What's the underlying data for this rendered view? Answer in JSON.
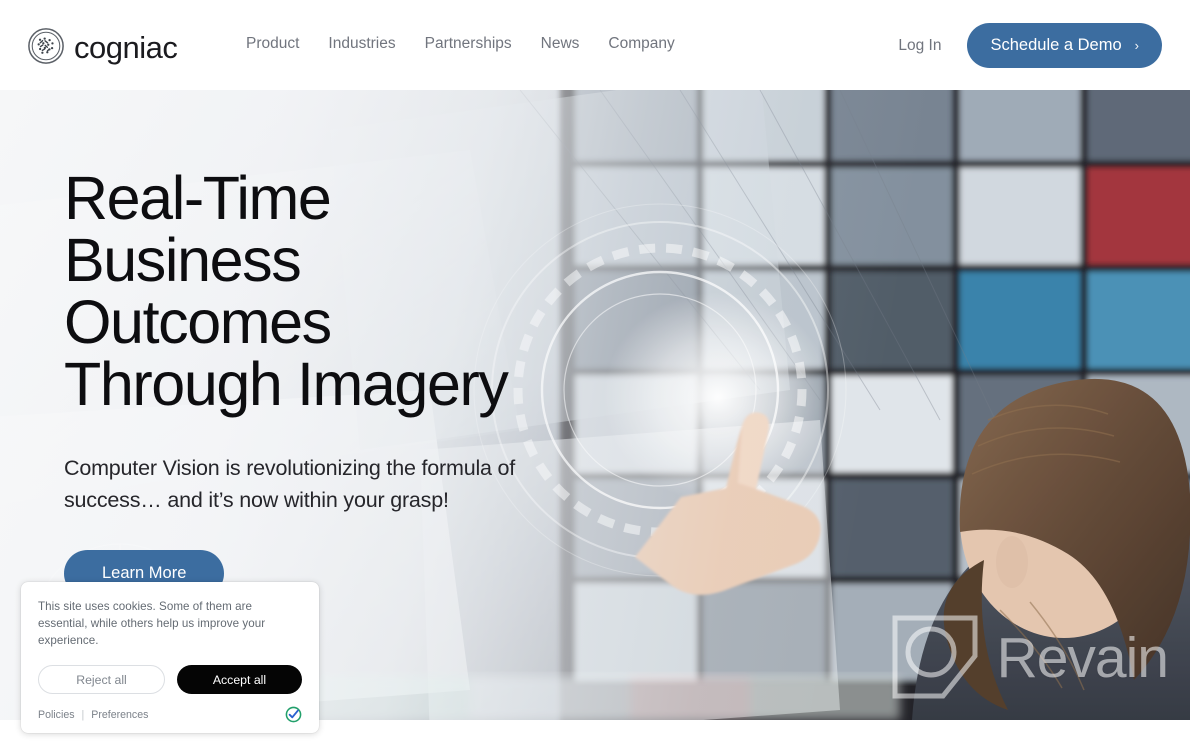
{
  "brand": {
    "name": "cogniac",
    "logo_icon": "cogniac-circle-mark-icon"
  },
  "nav": {
    "items": [
      {
        "label": "Product"
      },
      {
        "label": "Industries"
      },
      {
        "label": "Partnerships"
      },
      {
        "label": "News"
      },
      {
        "label": "Company"
      }
    ],
    "login_label": "Log In",
    "demo_label": "Schedule a Demo",
    "demo_chevron": "›"
  },
  "hero": {
    "title": "Real-Time Business Outcomes Through Imagery",
    "title_lines": [
      "Real-Time",
      "Business",
      "Outcomes",
      "Through Imagery"
    ],
    "subtitle": "Computer Vision is revolutionizing the formula of success… and it’s now within your grasp!",
    "cta_label": "Learn More",
    "image_description": "Woman touching a futuristic interactive video wall of screens"
  },
  "watermark": {
    "text": "Revain",
    "logo_icon": "revain-square-circle-icon"
  },
  "cookie_banner": {
    "message": "This site uses cookies. Some of them are essential, while others help us improve your experience.",
    "reject_label": "Reject all",
    "accept_label": "Accept all",
    "policies_label": "Policies",
    "separator": "|",
    "preferences_label": "Preferences",
    "badge_icon": "usercentrics-check-badge-icon"
  },
  "colors": {
    "brand_blue": "#3c6da0",
    "nav_text": "#71757e",
    "heading": "#0d0d10",
    "accept_black": "#050505",
    "badge_green": "#22a06b",
    "badge_blue": "#2a61d0"
  }
}
